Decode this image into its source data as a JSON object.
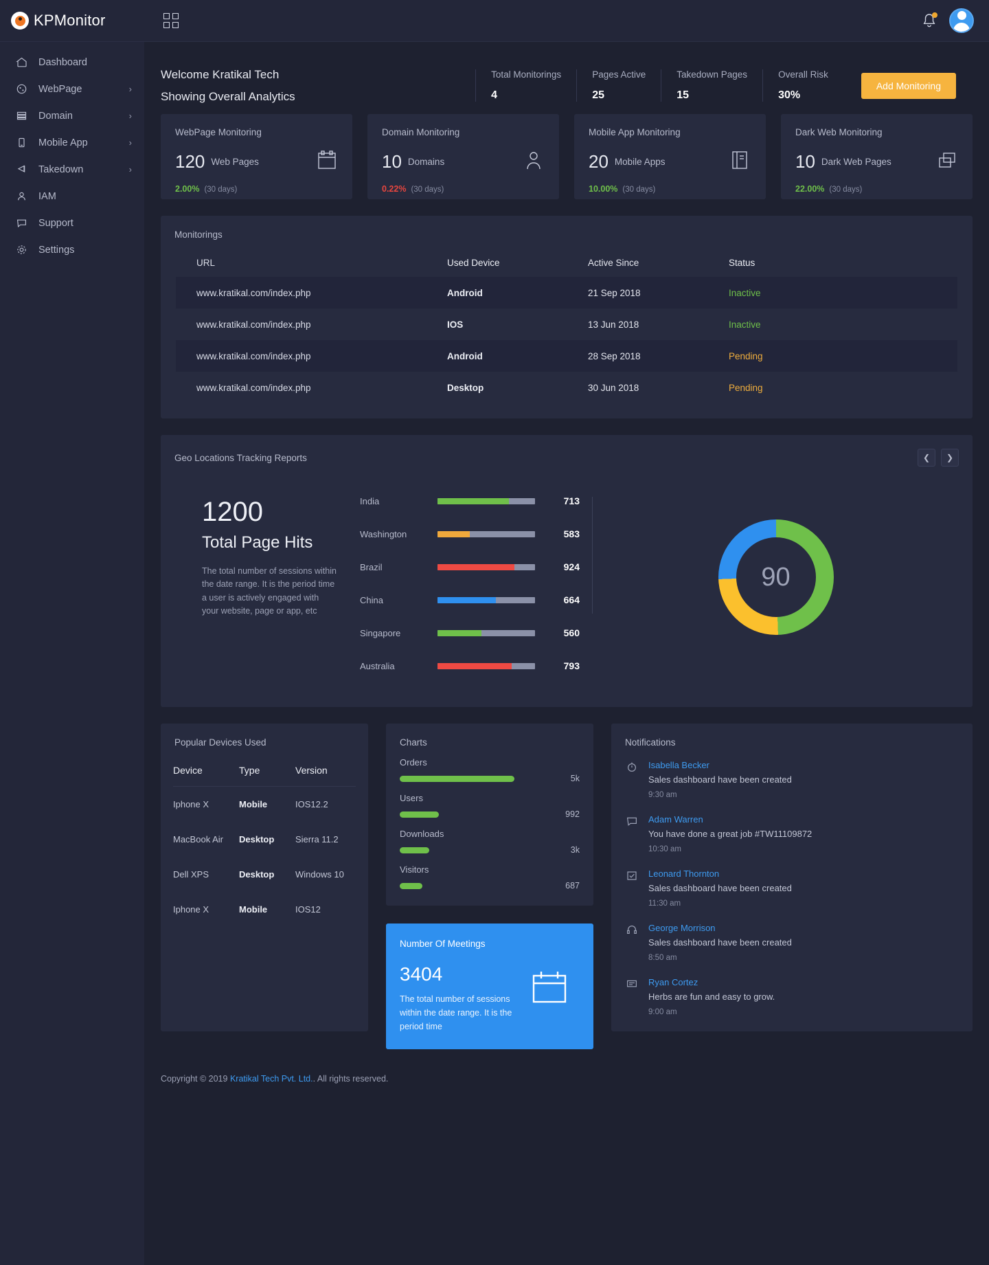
{
  "brand": {
    "name": "KPMonitor",
    "logo_icon": "eye-icon",
    "grid_icon": "grid-apps-icon",
    "bell_icon": "bell-icon",
    "avatar_icon": "user-avatar"
  },
  "sidebar": {
    "items": [
      {
        "label": "Dashboard",
        "icon": "home-icon",
        "chevron": ""
      },
      {
        "label": "WebPage",
        "icon": "globe-icon",
        "chevron": "›"
      },
      {
        "label": "Domain",
        "icon": "server-icon",
        "chevron": "›"
      },
      {
        "label": "Mobile App",
        "icon": "mobile-icon",
        "chevron": "›"
      },
      {
        "label": "Takedown",
        "icon": "flag-icon",
        "chevron": "›"
      },
      {
        "label": "IAM",
        "icon": "user-icon",
        "chevron": ""
      },
      {
        "label": "Support",
        "icon": "chat-icon",
        "chevron": ""
      },
      {
        "label": "Settings",
        "icon": "gear-icon",
        "chevron": ""
      }
    ]
  },
  "header": {
    "welcome": "Welcome Kratikal Tech",
    "subtitle": "Showing Overall Analytics",
    "stats": [
      {
        "label": "Total Monitorings",
        "value": "4"
      },
      {
        "label": "Pages Active",
        "value": "25"
      },
      {
        "label": "Takedown Pages",
        "value": "15"
      },
      {
        "label": "Overall Risk",
        "value": "30%"
      }
    ],
    "add_button": "Add Monitoring",
    "add_button_color": "#f6b43f"
  },
  "kpi_cards": [
    {
      "title": "WebPage Monitoring",
      "number": "120",
      "unit": "Web Pages",
      "pct": "2.00%",
      "pct_color": "#6fc04a",
      "days": "(30 days)",
      "icon": "calendar-icon"
    },
    {
      "title": "Domain Monitoring",
      "number": "10",
      "unit": "Domains",
      "pct": "0.22%",
      "pct_color": "#e8463f",
      "days": "(30 days)",
      "icon": "person-icon"
    },
    {
      "title": "Mobile App Monitoring",
      "number": "20",
      "unit": "Mobile Apps",
      "pct": "10.00%",
      "pct_color": "#6fc04a",
      "days": "(30 days)",
      "icon": "book-icon"
    },
    {
      "title": "Dark Web Monitoring",
      "number": "10",
      "unit": "Dark Web Pages",
      "pct": "22.00%",
      "pct_color": "#6fc04a",
      "days": "(30 days)",
      "icon": "windows-icon"
    }
  ],
  "monitorings": {
    "title": "Monitorings",
    "columns": [
      "URL",
      "Used Device",
      "Active Since",
      "Status"
    ],
    "rows": [
      {
        "url": "www.kratikal.com/index.php",
        "device": "Android",
        "since": "21 Sep 2018",
        "status": "Inactive",
        "status_type": "inactive"
      },
      {
        "url": "www.kratikal.com/index.php",
        "device": "IOS",
        "since": "13 Jun 2018",
        "status": "Inactive",
        "status_type": "inactive"
      },
      {
        "url": "www.kratikal.com/index.php",
        "device": "Android",
        "since": "28 Sep 2018",
        "status": "Pending",
        "status_type": "pending"
      },
      {
        "url": "www.kratikal.com/index.php",
        "device": "Desktop",
        "since": "30 Jun 2018",
        "status": "Pending",
        "status_type": "pending"
      }
    ]
  },
  "geo": {
    "title": "Geo Locations Tracking Reports",
    "prev_icon": "chevron-left-icon",
    "next_icon": "chevron-right-icon",
    "total": "1200",
    "total_label": "Total Page Hits",
    "description": "The total number of sessions within the date range. It is the period time a user is actively engaged with your website, page or app, etc",
    "donut_center": "90"
  },
  "chart_data": [
    {
      "type": "bar",
      "title": "Geo Locations Tracking Reports",
      "categories": [
        "India",
        "Washington",
        "Brazil",
        "China",
        "Singapore",
        "Australia"
      ],
      "values": [
        713,
        583,
        924,
        664,
        560,
        793
      ],
      "fill_percent": [
        73,
        33,
        79,
        60,
        45,
        76
      ],
      "colors": [
        "#6fc04a",
        "#f0a93c",
        "#ee4a43",
        "#2f90ef",
        "#6fc04a",
        "#ee4a43"
      ],
      "track_color": "#8b91a8",
      "orientation": "horizontal",
      "xlabel": "",
      "ylabel": "",
      "grid": false,
      "legend": false
    },
    {
      "type": "pie",
      "title": "Risk Distribution",
      "center_label": "90",
      "labels": [
        "Green",
        "Blue",
        "Yellow"
      ],
      "values": [
        50,
        25,
        25
      ],
      "colors": [
        "#6fc04a",
        "#2f90ef",
        "#fbc02d"
      ]
    },
    {
      "type": "bar",
      "title": "Charts",
      "categories": [
        "Orders",
        "Users",
        "Downloads",
        "Visitors"
      ],
      "values": [
        "5k",
        "992",
        "3k",
        "687"
      ],
      "fill_percent": [
        82,
        28,
        21,
        16
      ],
      "color": "#6fc04a",
      "orientation": "horizontal",
      "grid": false,
      "legend": false
    }
  ],
  "devices": {
    "title": "Popular Devices Used",
    "columns": [
      "Device",
      "Type",
      "Version"
    ],
    "rows": [
      {
        "device": "Iphone X",
        "type": "Mobile",
        "version": "IOS12.2"
      },
      {
        "device": "MacBook Air",
        "type": "Desktop",
        "version": "Sierra 11.2"
      },
      {
        "device": "Dell XPS",
        "type": "Desktop",
        "version": "Windows 10"
      },
      {
        "device": "Iphone X",
        "type": "Mobile",
        "version": "IOS12"
      }
    ]
  },
  "charts_panel": {
    "title": "Charts",
    "items": [
      {
        "label": "Orders",
        "value": "5k"
      },
      {
        "label": "Users",
        "value": "992"
      },
      {
        "label": "Downloads",
        "value": "3k"
      },
      {
        "label": "Visitors",
        "value": "687"
      }
    ]
  },
  "meetings": {
    "title": "Number Of Meetings",
    "number": "3404",
    "description": "The total number of sessions within the date range. It is the period time",
    "icon": "calendar-icon",
    "bg_color": "#2f90ef"
  },
  "notifications": {
    "title": "Notifications",
    "items": [
      {
        "name": "Isabella Becker",
        "text": "Sales dashboard have been created",
        "time": "9:30 am",
        "icon": "clock-icon"
      },
      {
        "name": "Adam Warren",
        "text": "You have done a great job #TW11109872",
        "time": "10:30 am",
        "icon": "comment-icon"
      },
      {
        "name": "Leonard Thornton",
        "text": "Sales dashboard have been created",
        "time": "11:30 am",
        "icon": "check-square-icon"
      },
      {
        "name": "George Morrison",
        "text": "Sales dashboard have been created",
        "time": "8:50 am",
        "icon": "headphone-icon"
      },
      {
        "name": "Ryan Cortez",
        "text": "Herbs are fun and easy to grow.",
        "time": "9:00 am",
        "icon": "message-icon"
      }
    ]
  },
  "footer": {
    "prefix": "Copyright © 2019 ",
    "link": "Kratikal Tech Pvt. Ltd.",
    "suffix": ". All rights reserved."
  }
}
